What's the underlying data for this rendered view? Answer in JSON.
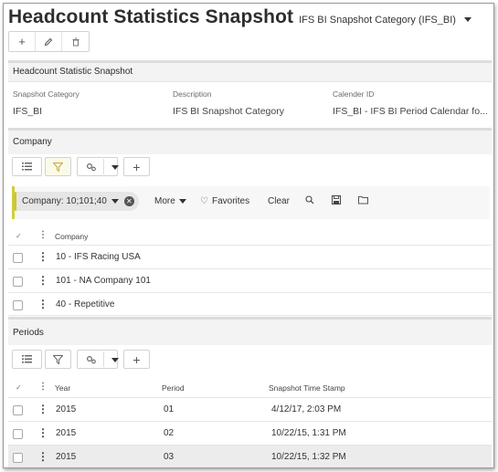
{
  "header": {
    "title": "Headcount Statistics Snapshot",
    "record_selector": "IFS BI Snapshot Category (IFS_BI)"
  },
  "toolbar": {
    "new_icon": "+",
    "edit_icon": "✎",
    "delete_icon": "🗑"
  },
  "snapshot": {
    "section_title": "Headcount Statistic Snapshot",
    "fields": {
      "category_label": "Snapshot Category",
      "category_value": "IFS_BI",
      "description_label": "Description",
      "description_value": "IFS BI Snapshot Category",
      "calendar_label": "Calender ID",
      "calendar_value": "IFS_BI - IFS BI Period Calendar fo..."
    }
  },
  "company": {
    "section_title": "Company",
    "filter": {
      "chip_label": "Company: 10;101;40",
      "more_label": "More",
      "favorites_label": "Favorites",
      "clear_label": "Clear"
    },
    "column_header": "Company",
    "rows": [
      "10 - IFS Racing USA",
      "101 - NA Company 101",
      "40 - Repetitive"
    ]
  },
  "periods": {
    "section_title": "Periods",
    "columns": {
      "year": "Year",
      "period": "Period",
      "timestamp": "Snapshot Time Stamp"
    },
    "rows": [
      {
        "year": "2015",
        "period": "01",
        "timestamp": "4/12/17, 2:03 PM"
      },
      {
        "year": "2015",
        "period": "02",
        "timestamp": "10/22/15, 1:31 PM"
      },
      {
        "year": "2015",
        "period": "03",
        "timestamp": "10/22/15, 1:32 PM"
      }
    ]
  },
  "colors": {
    "filter_accent": "#c8c637",
    "separator": "#dcdcdc"
  }
}
